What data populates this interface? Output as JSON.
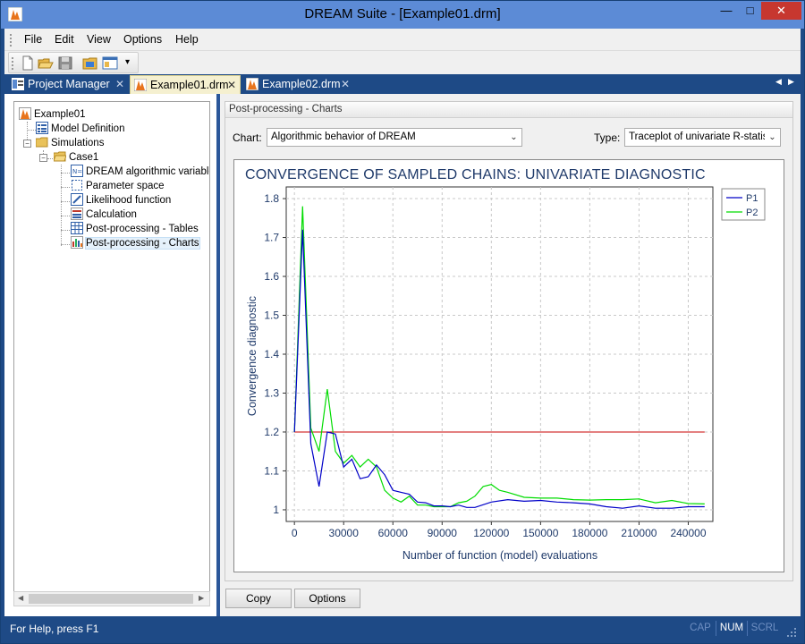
{
  "window": {
    "title": "DREAM Suite - [Example01.drm]",
    "minimize_glyph": "—",
    "maximize_glyph": "□",
    "close_glyph": "✕"
  },
  "menu": {
    "items": [
      "File",
      "Edit",
      "View",
      "Options",
      "Help"
    ]
  },
  "toolbar": {
    "buttons": [
      "new-file-icon",
      "open-folder-icon",
      "save-icon",
      "browse-folder-icon",
      "view-panel-icon"
    ],
    "overflow_glyph": "▾"
  },
  "tabs": [
    {
      "label": "Project Manager",
      "close": "✕",
      "active": false
    },
    {
      "label": "Example01.drm",
      "close": "✕",
      "active": true
    },
    {
      "label": "Example02.drm",
      "close": "✕",
      "active": false
    }
  ],
  "tab_scroll": {
    "left": "◀",
    "right": "▶"
  },
  "tree": {
    "root": "Example01",
    "model_definition": "Model Definition",
    "simulations": "Simulations",
    "case": "Case1",
    "children": [
      "DREAM algorithmic variables",
      "Parameter space",
      "Likelihood function",
      "Calculation",
      "Post-processing - Tables",
      "Post-processing - Charts"
    ],
    "expander_minus": "−",
    "scroll_left": "◀",
    "scroll_right": "▶"
  },
  "panel": {
    "title": "Post-processing - Charts",
    "chart_label": "Chart:",
    "chart_value": "Algorithmic behavior of DREAM",
    "type_label": "Type:",
    "type_value": "Traceplot of univariate R-statistic",
    "combo_arrow": "⌄",
    "copy_button": "Copy",
    "options_button": "Options"
  },
  "chart_data": {
    "type": "line",
    "title": "CONVERGENCE OF SAMPLED CHAINS: UNIVARIATE DIAGNOSTIC",
    "xlabel": "Number of function (model) evaluations",
    "ylabel": "Convergence diagnostic",
    "xlim": [
      -5000,
      255000
    ],
    "ylim": [
      0.97,
      1.83
    ],
    "xticks": [
      0,
      30000,
      60000,
      90000,
      120000,
      150000,
      180000,
      210000,
      240000
    ],
    "yticks": [
      1,
      1.1,
      1.2,
      1.3,
      1.4,
      1.5,
      1.6,
      1.7,
      1.8
    ],
    "ytick_labels": [
      "1",
      "1.1",
      "1.2",
      "1.3",
      "1.4",
      "1.5",
      "1.6",
      "1.7",
      "1.8"
    ],
    "grid": true,
    "legend_position": "top-right",
    "series": [
      {
        "name": "P1",
        "color": "#0000c8",
        "x": [
          0,
          5000,
          10000,
          15000,
          20000,
          25000,
          30000,
          35000,
          40000,
          45000,
          50000,
          55000,
          60000,
          65000,
          70000,
          75000,
          80000,
          85000,
          90000,
          95000,
          100000,
          105000,
          110000,
          120000,
          130000,
          140000,
          150000,
          160000,
          170000,
          180000,
          190000,
          200000,
          210000,
          220000,
          230000,
          240000,
          250000
        ],
        "y": [
          1.2,
          1.72,
          1.17,
          1.06,
          1.2,
          1.195,
          1.11,
          1.13,
          1.08,
          1.085,
          1.115,
          1.09,
          1.05,
          1.045,
          1.04,
          1.02,
          1.018,
          1.01,
          1.01,
          1.008,
          1.012,
          1.006,
          1.006,
          1.02,
          1.026,
          1.022,
          1.024,
          1.02,
          1.018,
          1.015,
          1.008,
          1.004,
          1.01,
          1.004,
          1.004,
          1.008,
          1.008
        ]
      },
      {
        "name": "P2",
        "color": "#00dc00",
        "x": [
          0,
          5000,
          10000,
          15000,
          20000,
          25000,
          30000,
          35000,
          40000,
          45000,
          50000,
          55000,
          60000,
          65000,
          70000,
          75000,
          80000,
          85000,
          90000,
          95000,
          100000,
          105000,
          110000,
          115000,
          120000,
          125000,
          130000,
          140000,
          150000,
          160000,
          170000,
          180000,
          190000,
          200000,
          210000,
          220000,
          230000,
          240000,
          250000
        ],
        "y": [
          1.2,
          1.78,
          1.21,
          1.15,
          1.31,
          1.15,
          1.12,
          1.14,
          1.11,
          1.13,
          1.11,
          1.05,
          1.03,
          1.02,
          1.035,
          1.012,
          1.012,
          1.008,
          1.008,
          1.008,
          1.018,
          1.022,
          1.035,
          1.06,
          1.065,
          1.05,
          1.045,
          1.032,
          1.03,
          1.03,
          1.026,
          1.025,
          1.026,
          1.026,
          1.028,
          1.018,
          1.024,
          1.016,
          1.015
        ]
      }
    ],
    "threshold": {
      "y": 1.2,
      "x": [
        0,
        250000
      ],
      "color": "#c80000"
    }
  },
  "status": {
    "help_text": "For Help, press F1",
    "indicators": [
      {
        "label": "CAP",
        "on": false
      },
      {
        "label": "NUM",
        "on": true
      },
      {
        "label": "SCRL",
        "on": false
      }
    ]
  }
}
